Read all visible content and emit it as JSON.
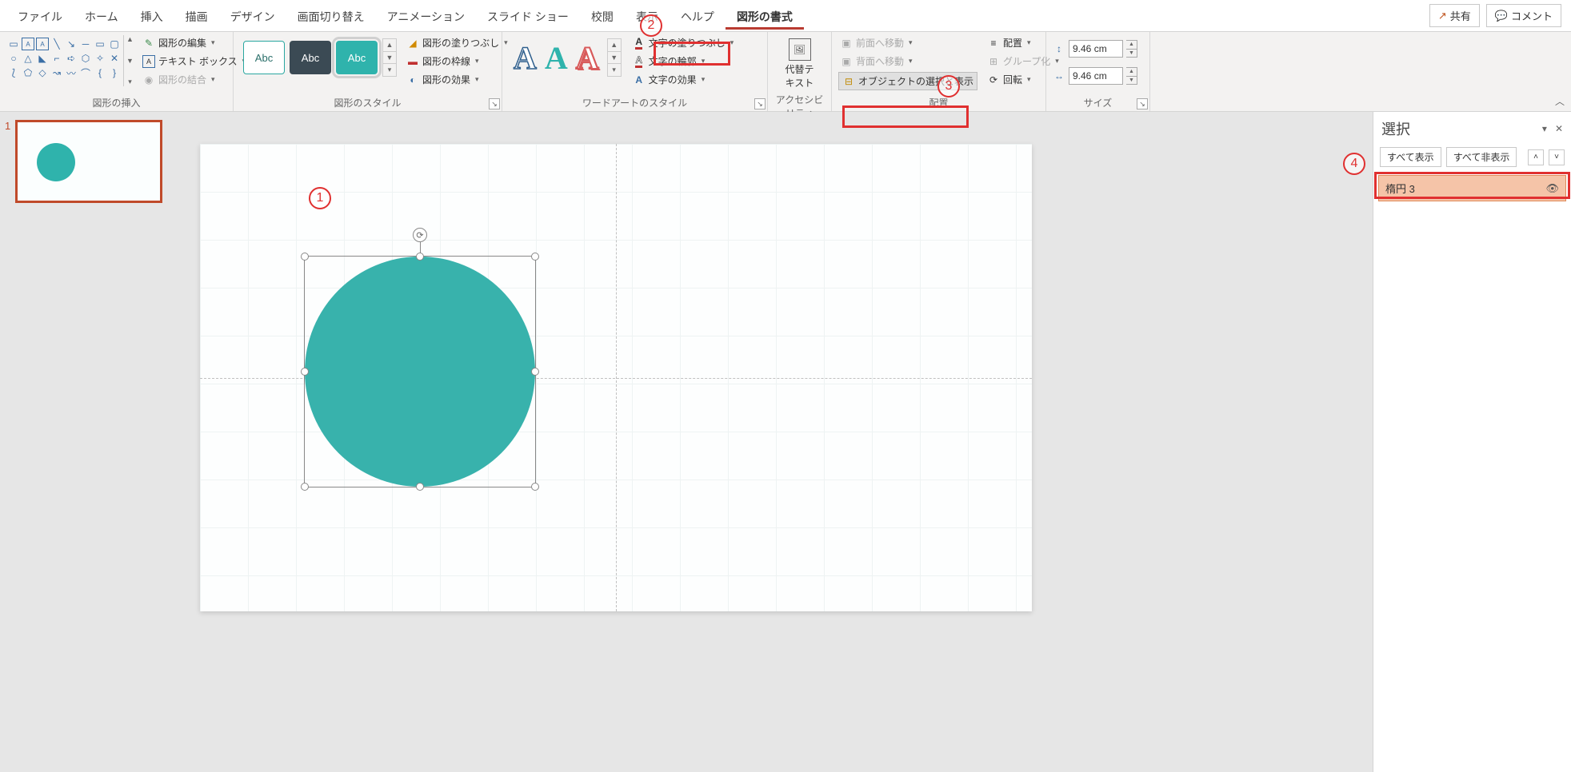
{
  "tabs": {
    "file": "ファイル",
    "home": "ホーム",
    "insert": "挿入",
    "draw": "描画",
    "design": "デザイン",
    "transitions": "画面切り替え",
    "animations": "アニメーション",
    "slideshow": "スライド ショー",
    "review": "校閲",
    "view": "表示",
    "help": "ヘルプ",
    "shape_format": "図形の書式"
  },
  "topright": {
    "share": "共有",
    "comment": "コメント"
  },
  "ribbon": {
    "insert_shapes": {
      "label": "図形の挿入",
      "edit_shape": "図形の編集",
      "text_box": "テキスト ボックス",
      "merge_shapes": "図形の結合"
    },
    "shape_styles": {
      "label": "図形のスタイル",
      "swatch_text": "Abc",
      "fill": "図形の塗りつぶし",
      "outline": "図形の枠線",
      "effects": "図形の効果"
    },
    "wordart": {
      "label": "ワードアートのスタイル",
      "glyph": "A",
      "text_fill": "文字の塗りつぶし",
      "text_outline": "文字の輪郭",
      "text_effects": "文字の効果"
    },
    "accessibility": {
      "label": "アクセシビリティ",
      "alt_text": "代替テキスト"
    },
    "arrange": {
      "label": "配置",
      "bring_forward": "前面へ移動",
      "send_backward": "背面へ移動",
      "selection_pane": "オブジェクトの選択と表示",
      "align": "配置",
      "group": "グループ化",
      "rotate": "回転"
    },
    "size": {
      "label": "サイズ",
      "height": "9.46 cm",
      "width": "9.46 cm"
    }
  },
  "thumbnails": {
    "slide1_num": "1"
  },
  "selection_pane": {
    "title": "選択",
    "show_all": "すべて表示",
    "hide_all": "すべて非表示",
    "item1": "楕円 3"
  },
  "annotations": {
    "a1": "1",
    "a2": "2",
    "a3": "3",
    "a4": "4"
  }
}
